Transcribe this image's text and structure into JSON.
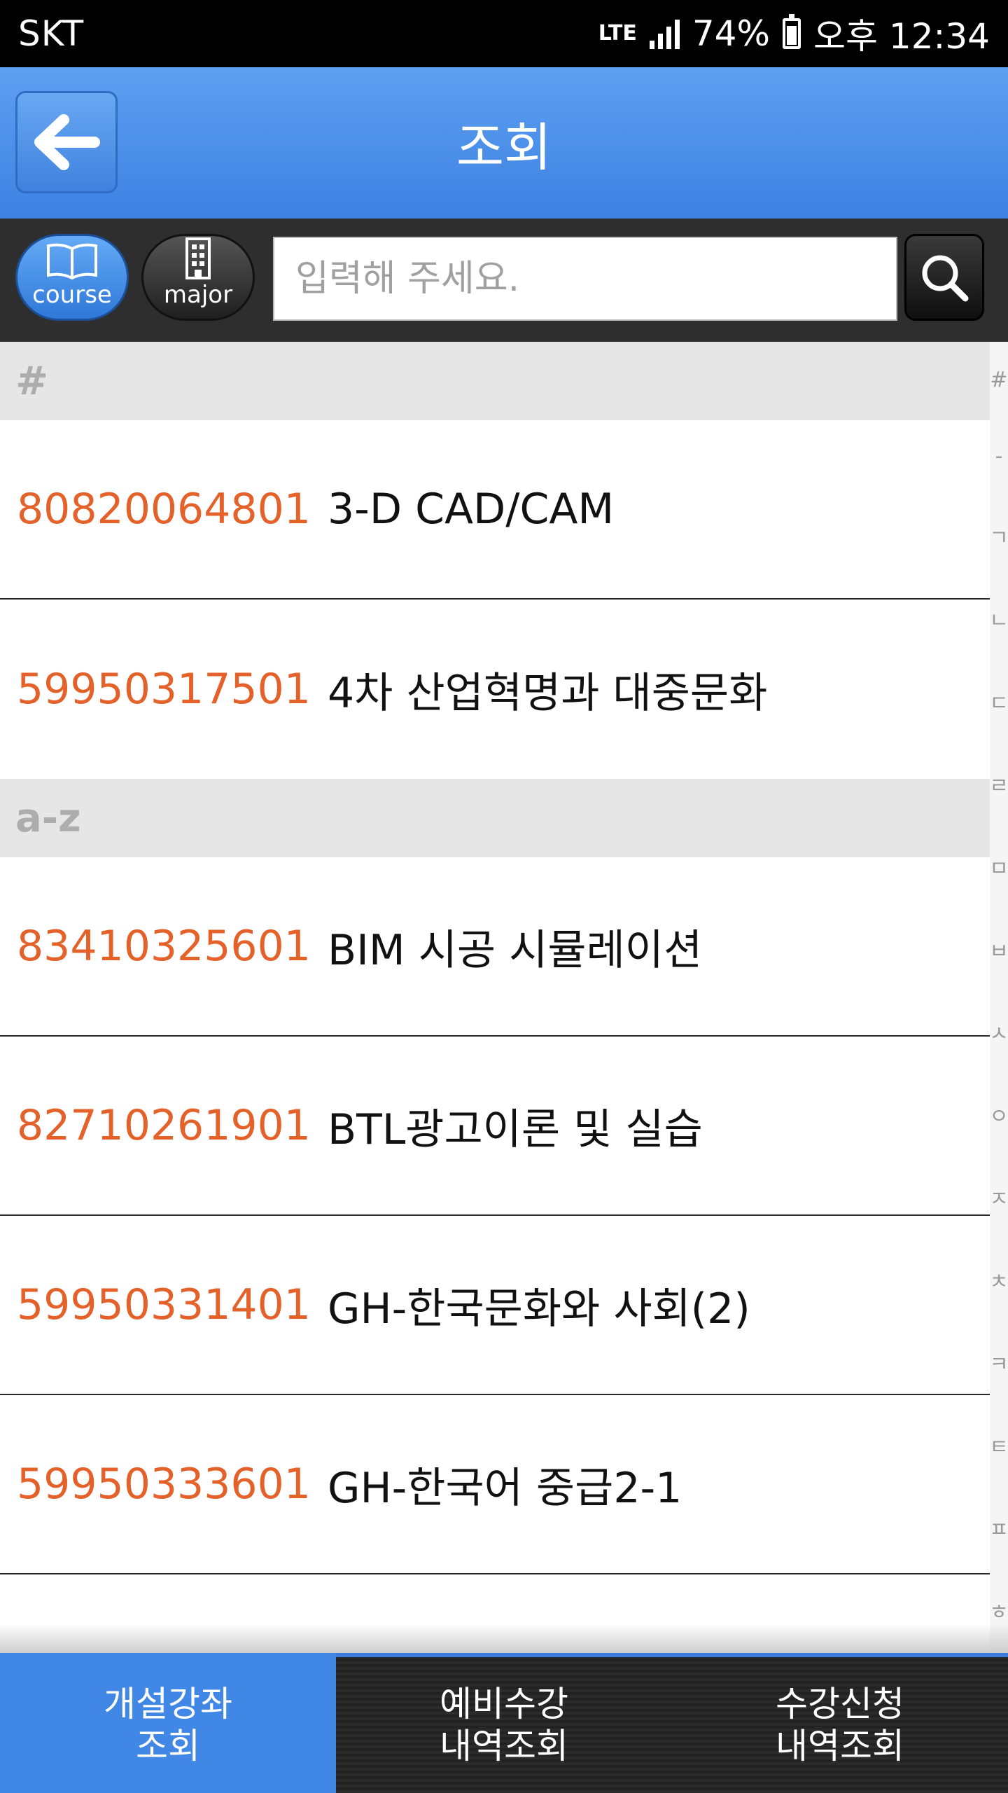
{
  "status_bar": {
    "carrier": "SKT",
    "network": "LTE",
    "battery": "74%",
    "time": "오후 12:34"
  },
  "header": {
    "title": "조회",
    "back_icon": "back-arrow-icon"
  },
  "toolbar": {
    "course_label": "course",
    "major_label": "major",
    "search_placeholder": "입력해 주세요.",
    "search_value": ""
  },
  "sections": [
    {
      "header": "#",
      "rows": [
        {
          "code": "80820064801",
          "name": "3-D CAD/CAM"
        },
        {
          "code": "59950317501",
          "name": "4차 산업혁명과 대중문화"
        }
      ]
    },
    {
      "header": "a-z",
      "rows": [
        {
          "code": "83410325601",
          "name": "BIM 시공 시뮬레이션"
        },
        {
          "code": "82710261901",
          "name": "BTL광고이론 및 실습"
        },
        {
          "code": "59950331401",
          "name": "GH-한국문화와 사회(2)"
        },
        {
          "code": "59950333601",
          "name": "GH-한국어 중급2-1"
        }
      ]
    }
  ],
  "index": [
    "#",
    "-",
    "ㄱ",
    "ㄴ",
    "ㄷ",
    "ㄹ",
    "ㅁ",
    "ㅂ",
    "ㅅ",
    "ㅇ",
    "ㅈ",
    "ㅊ",
    "ㅋ",
    "ㅌ",
    "ㅍ",
    "ㅎ"
  ],
  "tabs": [
    {
      "label": "개설강좌\n조회",
      "active": true
    },
    {
      "label": "예비수강\n내역조회",
      "active": false
    },
    {
      "label": "수강신청\n내역조회",
      "active": false
    }
  ],
  "colors": {
    "accent": "#4187e6",
    "code": "#e4612a",
    "header_bg": "#5e9ff0"
  }
}
